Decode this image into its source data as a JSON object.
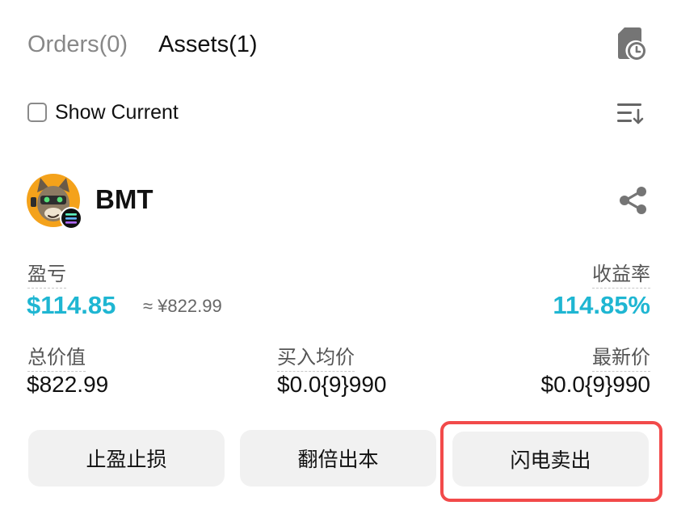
{
  "tabs": [
    {
      "label": "Orders(0)",
      "active": false
    },
    {
      "label": "Assets(1)",
      "active": true
    }
  ],
  "icons": {
    "history": "history-clock-icon",
    "sort": "sort-list-icon",
    "share": "share-icon",
    "chain_badge": "solana-badge-icon"
  },
  "filter": {
    "show_current_label": "Show Current",
    "checked": false
  },
  "asset": {
    "symbol": "BMT",
    "pnl_label": "盈亏",
    "pnl_value": "$114.85",
    "pnl_cny": "≈ ¥822.99",
    "yield_label": "收益率",
    "yield_value": "114.85%",
    "total_value_label": "总价值",
    "total_value": "$822.99",
    "avg_buy_label": "买入均价",
    "avg_buy_value": "$0.0{9}990",
    "latest_price_label": "最新价",
    "latest_price_value": "$0.0{9}990"
  },
  "actions": {
    "stop_label": "止盈止损",
    "double_label": "翻倍出本",
    "flash_sell_label": "闪电卖出"
  },
  "colors": {
    "accent": "#1fb6d2",
    "highlight": "#f24a4a",
    "button_bg": "#f1f1f1"
  }
}
